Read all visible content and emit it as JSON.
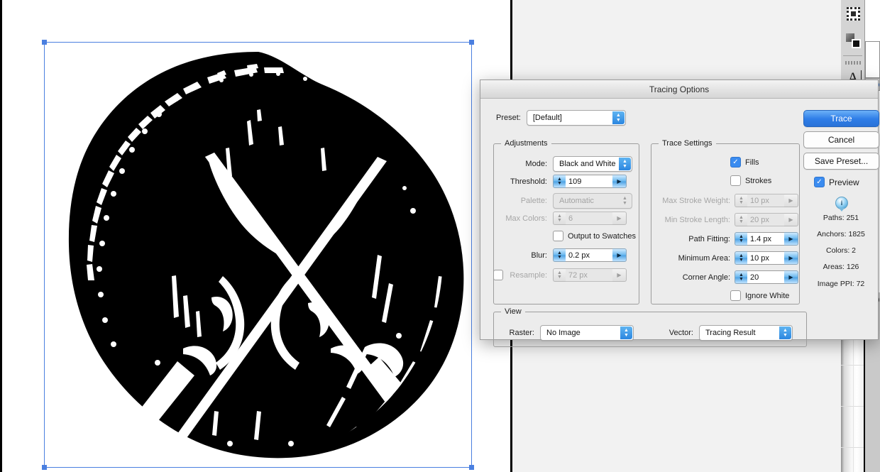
{
  "app": {
    "canvas_background": "#ffffff",
    "workspace_background": "#f2f2f2",
    "accent_blue": "#3b8cf0",
    "selection_blue": "#4a7fe0"
  },
  "artwork": {
    "name": "crossed-swords-emblem",
    "description": "Black circular woodcut emblem with two crossed swords rendered in white line work",
    "fill_color": "#000000",
    "line_color": "#ffffff"
  },
  "toolpanel": {
    "items": [
      {
        "icon": "artboard-tool-icon"
      },
      {
        "icon": "shape-tool-icon"
      },
      {
        "icon": "dotted-handle-icon"
      },
      {
        "icon": "type-tool-icon"
      }
    ]
  },
  "dialog": {
    "title": "Tracing Options",
    "preset": {
      "label": "Preset:",
      "value": "[Default]"
    },
    "adjustments": {
      "title": "Adjustments",
      "mode": {
        "label": "Mode:",
        "value": "Black and White",
        "enabled": true
      },
      "threshold": {
        "label": "Threshold:",
        "value": "109",
        "enabled": true
      },
      "palette": {
        "label": "Palette:",
        "value": "Automatic",
        "enabled": false
      },
      "max_colors": {
        "label": "Max Colors:",
        "value": "6",
        "enabled": false
      },
      "output_to_swatches": {
        "label": "Output to Swatches",
        "checked": false,
        "enabled": true
      },
      "blur": {
        "label": "Blur:",
        "value": "0.2 px",
        "enabled": true
      },
      "resample": {
        "label": "Resample:",
        "value": "72 px",
        "checked": false,
        "enabled": false
      }
    },
    "trace_settings": {
      "title": "Trace Settings",
      "fills": {
        "label": "Fills",
        "checked": true,
        "enabled": true
      },
      "strokes": {
        "label": "Strokes",
        "checked": false,
        "enabled": true
      },
      "max_stroke_weight": {
        "label": "Max Stroke Weight:",
        "value": "10 px",
        "enabled": false
      },
      "min_stroke_length": {
        "label": "Min Stroke Length:",
        "value": "20 px",
        "enabled": false
      },
      "path_fitting": {
        "label": "Path Fitting:",
        "value": "1.4 px",
        "enabled": true
      },
      "minimum_area": {
        "label": "Minimum Area:",
        "value": "10 px",
        "enabled": true
      },
      "corner_angle": {
        "label": "Corner Angle:",
        "value": "20",
        "enabled": true
      },
      "ignore_white": {
        "label": "Ignore White",
        "checked": false,
        "enabled": true
      }
    },
    "view": {
      "title": "View",
      "raster": {
        "label": "Raster:",
        "value": "No Image"
      },
      "vector": {
        "label": "Vector:",
        "value": "Tracing Result"
      }
    },
    "buttons": {
      "trace": "Trace",
      "cancel": "Cancel",
      "save_preset": "Save Preset..."
    },
    "preview": {
      "label": "Preview",
      "checked": true
    },
    "info_icon": "info-icon",
    "stats": [
      "Paths: 251",
      "Anchors: 1825",
      "Colors: 2",
      "Areas: 126",
      "Image PPI: 72"
    ]
  }
}
